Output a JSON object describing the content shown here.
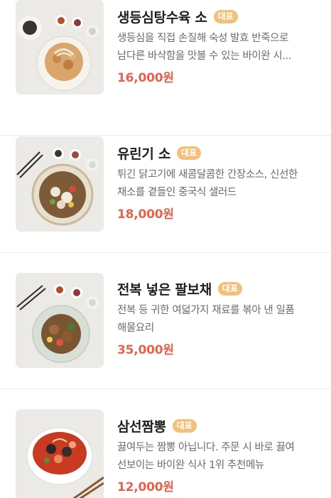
{
  "badge_label": "대표",
  "colors": {
    "badge": "#f3c07a",
    "price": "#e4634a",
    "description": "#6b6b6b",
    "title": "#1e1e1e"
  },
  "menu": [
    {
      "name": "생등심탕수육 소",
      "description_lines": [
        "생등심을 직접 손질해 숙성 발효 반죽으로",
        "남다른 바삭함을 맛볼 수 있는 바이완 시..."
      ],
      "price": "16,000원",
      "image_icon": "sweet-and-sour-pork-dish-photo"
    },
    {
      "name": "유린기 소",
      "description_lines": [
        "튀긴 닭고기에 새콤달콤한 간장소스, 신선한",
        "채소를 곁들인 중국식 샐러드"
      ],
      "price": "18,000원",
      "image_icon": "yuringi-chicken-dish-photo"
    },
    {
      "name": "전복 넣은 팔보채",
      "description_lines": [
        "전복 등 귀한 여덟가지 재료를 볶아 낸 일품",
        "해물요리"
      ],
      "price": "35,000원",
      "image_icon": "palbochae-seafood-dish-photo"
    },
    {
      "name": "삼선짬뽕",
      "description_lines": [
        "끓여두는 짬뽕 아닙니다. 주문 시 바로 끓여",
        "선보이는 바이완 식사 1위 추천메뉴"
      ],
      "price": "12,000원",
      "image_icon": "seafood-jjamppong-noodle-photo"
    }
  ]
}
